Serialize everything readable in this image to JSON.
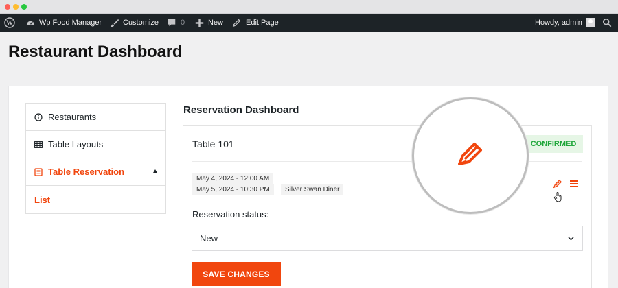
{
  "adminbar": {
    "site_name": "Wp Food Manager",
    "customize_label": "Customize",
    "comments_count": "0",
    "new_label": "New",
    "edit_page_label": "Edit Page",
    "howdy_label": "Howdy, admin"
  },
  "page": {
    "title": "Restaurant Dashboard"
  },
  "sidebar": {
    "items": [
      {
        "label": "Restaurants",
        "icon": "info-circle-icon"
      },
      {
        "label": "Table Layouts",
        "icon": "table-grid-icon"
      },
      {
        "label": "Table Reservation",
        "icon": "reservation-icon"
      },
      {
        "label": "List"
      }
    ]
  },
  "main": {
    "section_title": "Reservation Dashboard",
    "reservation": {
      "table_name": "Table 101",
      "status_badge": "CONFIRMED",
      "start_datetime": "May 4, 2024 - 12:00 AM",
      "end_datetime": "May 5, 2024 - 10:30 PM",
      "restaurant": "Silver Swan Diner"
    },
    "status_label": "Reservation status:",
    "status_value": "New",
    "save_label": "SAVE CHANGES"
  },
  "colors": {
    "accent": "#f1460e",
    "confirmed_text": "#1ea639",
    "confirmed_bg": "#e6f6e6",
    "adminbar_bg": "#1d2327"
  }
}
